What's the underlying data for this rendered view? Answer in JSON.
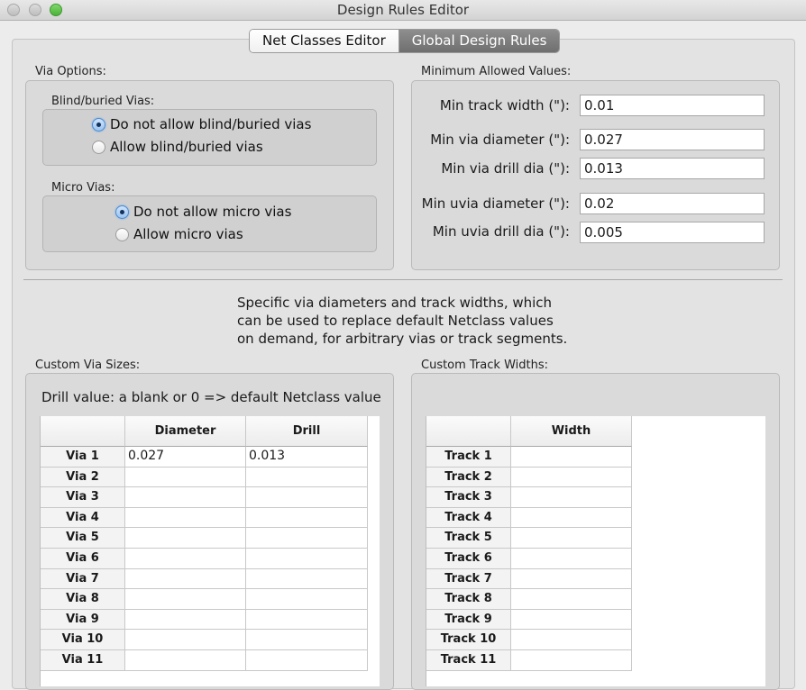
{
  "window": {
    "title": "Design Rules Editor"
  },
  "tabs": [
    {
      "label": "Net Classes Editor",
      "active": false
    },
    {
      "label": "Global Design Rules",
      "active": true
    }
  ],
  "via_options": {
    "label": "Via Options:",
    "blind": {
      "label": "Blind/buried Vias:",
      "options": [
        "Do not allow blind/buried vias",
        "Allow blind/buried vias"
      ],
      "selected": 0
    },
    "micro": {
      "label": "Micro Vias:",
      "options": [
        "Do not allow micro vias",
        "Allow micro vias"
      ],
      "selected": 0
    }
  },
  "min_values": {
    "label": "Minimum Allowed Values:",
    "fields": [
      {
        "label": "Min track width (\"):",
        "value": "0.01"
      },
      {
        "label": "Min via diameter (\"):",
        "value": "0.027"
      },
      {
        "label": "Min via drill dia (\"):",
        "value": "0.013"
      },
      {
        "label": "Min uvia diameter (\"):",
        "value": "0.02"
      },
      {
        "label": "Min uvia drill dia (\"):",
        "value": "0.005"
      }
    ]
  },
  "info": {
    "lines": [
      "Specific via diameters and track widths, which",
      "can be used to replace default Netclass values",
      "on demand, for arbitrary vias or track segments."
    ]
  },
  "custom_vias": {
    "label": "Custom Via Sizes:",
    "note": "Drill value: a blank or 0 => default Netclass value",
    "columns": [
      "Diameter",
      "Drill"
    ],
    "rows": [
      {
        "name": "Via 1",
        "diameter": "0.027",
        "drill": "0.013"
      },
      {
        "name": "Via 2",
        "diameter": "",
        "drill": ""
      },
      {
        "name": "Via 3",
        "diameter": "",
        "drill": ""
      },
      {
        "name": "Via 4",
        "diameter": "",
        "drill": ""
      },
      {
        "name": "Via 5",
        "diameter": "",
        "drill": ""
      },
      {
        "name": "Via 6",
        "diameter": "",
        "drill": ""
      },
      {
        "name": "Via 7",
        "diameter": "",
        "drill": ""
      },
      {
        "name": "Via 8",
        "diameter": "",
        "drill": ""
      },
      {
        "name": "Via 9",
        "diameter": "",
        "drill": ""
      },
      {
        "name": "Via 10",
        "diameter": "",
        "drill": ""
      },
      {
        "name": "Via 11",
        "diameter": "",
        "drill": ""
      }
    ]
  },
  "custom_tracks": {
    "label": "Custom Track Widths:",
    "columns": [
      "Width"
    ],
    "rows": [
      {
        "name": "Track 1",
        "width": ""
      },
      {
        "name": "Track 2",
        "width": ""
      },
      {
        "name": "Track 3",
        "width": ""
      },
      {
        "name": "Track 4",
        "width": ""
      },
      {
        "name": "Track 5",
        "width": ""
      },
      {
        "name": "Track 6",
        "width": ""
      },
      {
        "name": "Track 7",
        "width": ""
      },
      {
        "name": "Track 8",
        "width": ""
      },
      {
        "name": "Track 9",
        "width": ""
      },
      {
        "name": "Track 10",
        "width": ""
      },
      {
        "name": "Track 11",
        "width": ""
      }
    ]
  }
}
